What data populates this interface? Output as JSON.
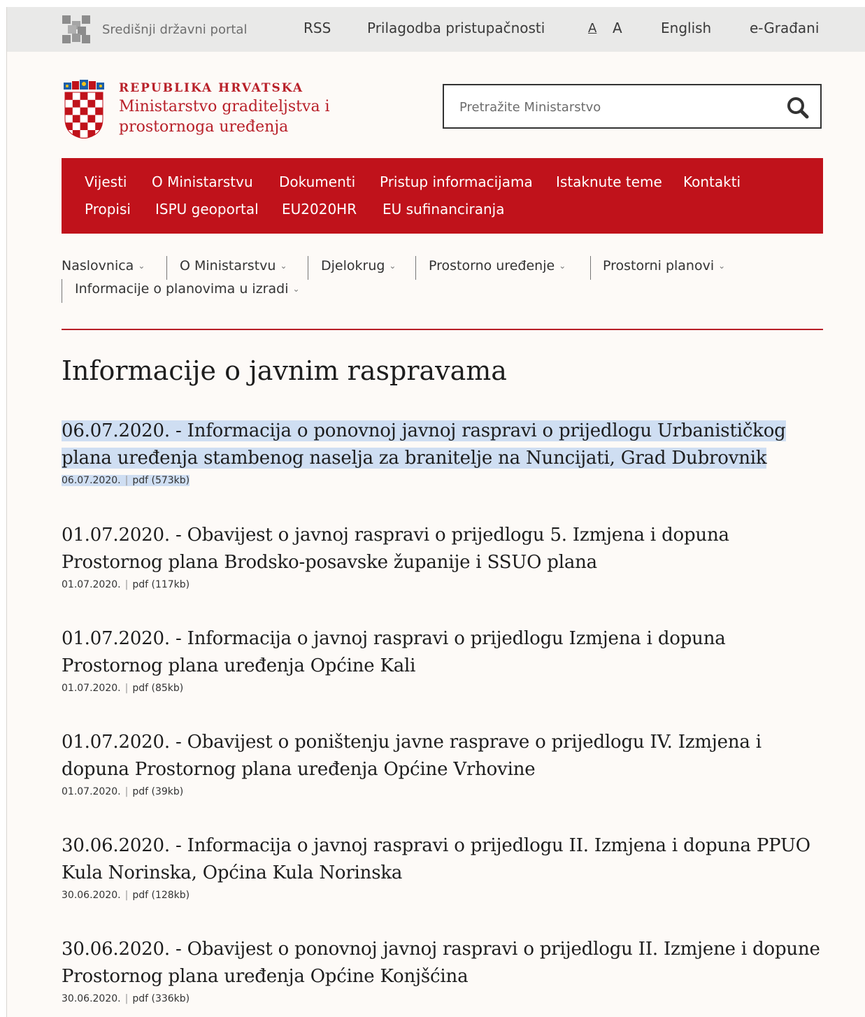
{
  "topbar": {
    "portal_label": "Središnji državni portal",
    "links": {
      "rss": "RSS",
      "accessibility": "Prilagodba pristupačnosti",
      "font_small": "A",
      "font_large": "A",
      "english": "English",
      "egradani": "e-Građani"
    }
  },
  "header": {
    "republic": "REPUBLIKA HRVATSKA",
    "ministry": "Ministarstvo graditeljstva i prostornoga uređenja",
    "search_placeholder": "Pretražite Ministarstvo"
  },
  "main_nav": {
    "row1": [
      "Vijesti",
      "O Ministarstvu",
      "Dokumenti",
      "Pristup informacijama",
      "Istaknute teme",
      "Kontakti"
    ],
    "row2": [
      "Propisi",
      "ISPU geoportal",
      "EU2020HR",
      "EU sufinanciranja"
    ]
  },
  "sub_nav": [
    "Naslovnica",
    "O Ministarstvu",
    "Djelokrug",
    "Prostorno uređenje",
    "Prostorni planovi",
    "Informacije o planovima u izradi"
  ],
  "page_title": "Informacije o javnim raspravama",
  "items": [
    {
      "title": "06.07.2020. - Informacija o ponovnoj javnoj raspravi o prijedlogu Urbanističkog plana uređenja stambenog naselja za branitelje na Nuncijati, Grad Dubrovnik",
      "date": "06.07.2020.",
      "file": "pdf (573kb)",
      "selected": true
    },
    {
      "title": "01.07.2020. - Obavijest o javnoj raspravi o prijedlogu 5. Izmjena i dopuna Prostornog plana Brodsko-posavske županije i SSUO plana",
      "date": "01.07.2020.",
      "file": "pdf (117kb)"
    },
    {
      "title": "01.07.2020. - Informacija o javnoj raspravi o prijedlogu Izmjena i dopuna Prostornog plana uređenja Općine Kali",
      "date": "01.07.2020.",
      "file": "pdf (85kb)"
    },
    {
      "title": "01.07.2020. - Obavijest o poništenju javne rasprave o prijedlogu IV. Izmjena i dopuna Prostornog plana uređenja Općine Vrhovine",
      "date": "01.07.2020.",
      "file": "pdf (39kb)"
    },
    {
      "title": "30.06.2020. - Informacija o javnoj raspravi o prijedlogu II. Izmjena i dopuna PPUO Kula Norinska, Općina Kula Norinska",
      "date": "30.06.2020.",
      "file": "pdf (128kb)"
    },
    {
      "title": "30.06.2020. - Obavijest o ponovnoj javnoj raspravi o prijedlogu II. Izmjene i dopune Prostornog plana uređenja Općine Konjšćina",
      "date": "30.06.2020.",
      "file": "pdf (336kb)"
    }
  ],
  "colors": {
    "brand_red": "#c0121b",
    "selection": "#cfdef2",
    "topbar_gray": "#e9e9e8"
  }
}
